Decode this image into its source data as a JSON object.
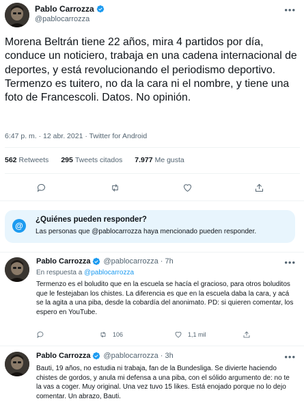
{
  "main_tweet": {
    "display_name": "Pablo Carrozza",
    "handle": "@pablocarrozza",
    "text": "Morena Beltrán tiene 22 años, mira 4 partidos por día, conduce un noticiero, trabaja en una cadena internacional de deportes, y está revolucionando el periodismo deportivo. Termenzo es tuitero, no da la cara ni el nombre, y tiene una foto de Francescoli. Datos. No opinión.",
    "meta": "6:47 p. m. · 12 abr. 2021 · Twitter for Android",
    "stats": {
      "retweets_count": "562",
      "retweets_label": "Retweets",
      "quotes_count": "295",
      "quotes_label": "Tweets citados",
      "likes_count": "7.977",
      "likes_label": "Me gusta"
    }
  },
  "reply_restriction": {
    "title": "¿Quiénes pueden responder?",
    "text_before": "Las personas que ",
    "mention": "@pablocarrozza",
    "text_after": " haya mencionado pueden responder."
  },
  "replies": [
    {
      "display_name": "Pablo Carrozza",
      "handle": "@pablocarrozza",
      "time": "· 7h",
      "reply_to_label": "En respuesta a",
      "reply_to_mention": "@pablocarrozza",
      "text": "Termenzo es el boludito que en la escuela se hacía el gracioso, para otros boluditos que le festejaban los chistes. La diferencia es que en la escuela daba la cara, y acá se la agita a una piba, desde la cobardía del anonimato. PD: si quieren comentar, los espero en YouTube.",
      "retweets": "106",
      "likes": "1,1 mil"
    },
    {
      "display_name": "Pablo Carrozza",
      "handle": "@pablocarrozza",
      "time": "· 3h",
      "text": "Bauti, 19 años, no estudia ni trabaja, fan de la Bundesliga. Se divierte haciendo chistes de gordos, y anula mi defensa a una piba, con el sólido argumento de: no te la vas a coger. Muy original. Una vez tuvo 15 likes. Está enojado porque no lo dejo comentar. Un abrazo, Bauti."
    }
  ],
  "icons": {
    "more": "more-horizontal-icon",
    "verified": "verified-badge-icon",
    "reply": "reply-icon",
    "retweet": "retweet-icon",
    "like": "like-icon",
    "share": "share-icon",
    "mention": "at-sign-icon"
  },
  "colors": {
    "accent": "#1d9bf0",
    "muted": "#536471",
    "reply_box_bg": "#e8f5fd"
  }
}
